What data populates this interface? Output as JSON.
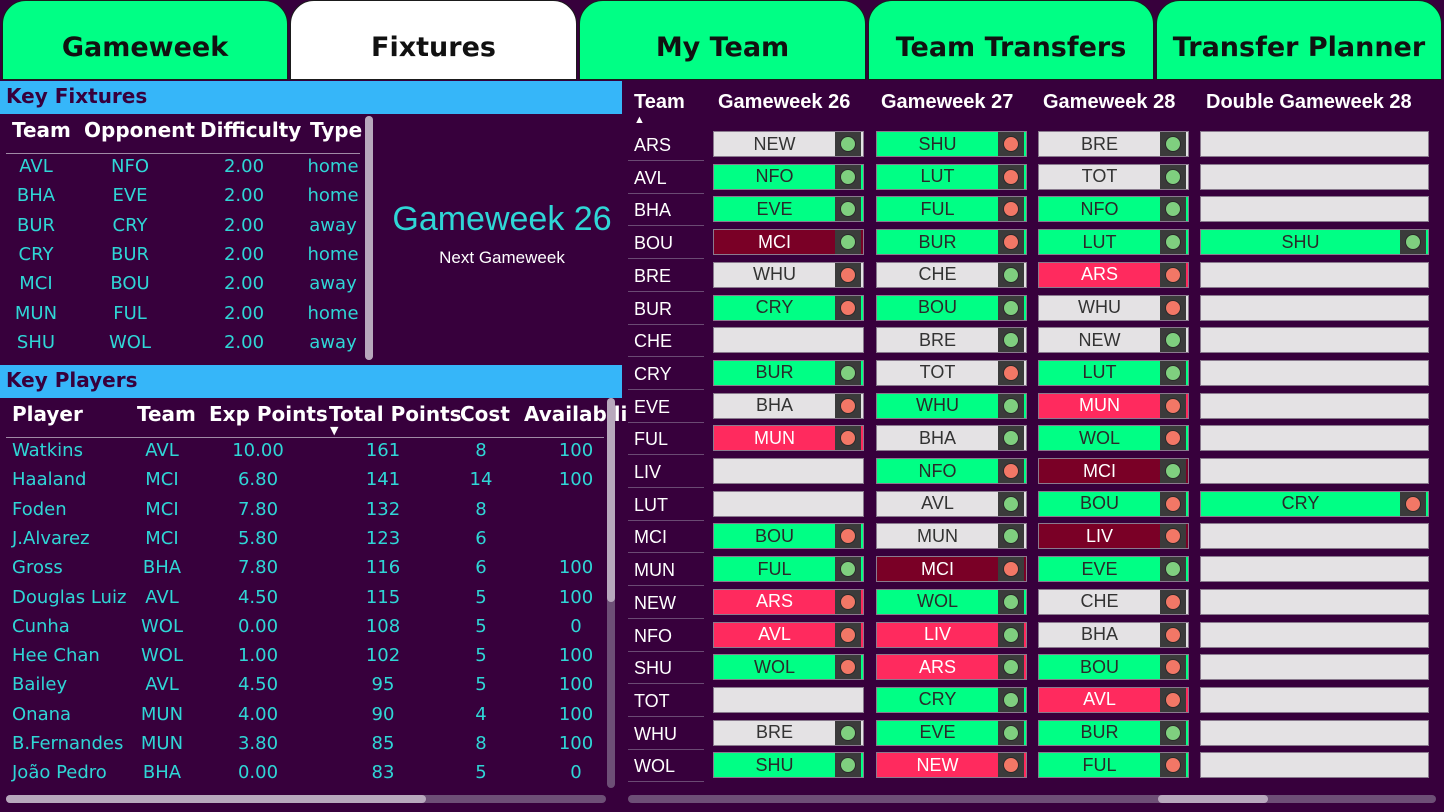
{
  "tabs": [
    {
      "label": "Gameweek",
      "active": false
    },
    {
      "label": "Fixtures",
      "active": true
    },
    {
      "label": "My Team",
      "active": false
    },
    {
      "label": "Team Transfers",
      "active": false
    },
    {
      "label": "Transfer Planner",
      "active": false
    }
  ],
  "key_fixtures": {
    "title": "Key Fixtures",
    "columns": [
      "Team",
      "Opponent",
      "Difficulty",
      "Type"
    ],
    "rows": [
      [
        "AVL",
        "NFO",
        "2.00",
        "home"
      ],
      [
        "BHA",
        "EVE",
        "2.00",
        "home"
      ],
      [
        "BUR",
        "CRY",
        "2.00",
        "away"
      ],
      [
        "CRY",
        "BUR",
        "2.00",
        "home"
      ],
      [
        "MCI",
        "BOU",
        "2.00",
        "away"
      ],
      [
        "MUN",
        "FUL",
        "2.00",
        "home"
      ],
      [
        "SHU",
        "WOL",
        "2.00",
        "away"
      ]
    ]
  },
  "gameweek_card": {
    "title": "Gameweek 26",
    "subtitle": "Next Gameweek"
  },
  "key_players": {
    "title": "Key Players",
    "columns": [
      "Player",
      "Team",
      "Exp Points",
      "Total Points",
      "Cost",
      "Availabili"
    ],
    "sort_column": "Total Points",
    "rows": [
      [
        "Watkins",
        "AVL",
        "10.00",
        "161",
        "8",
        "100"
      ],
      [
        "Haaland",
        "MCI",
        "6.80",
        "141",
        "14",
        "100"
      ],
      [
        "Foden",
        "MCI",
        "7.80",
        "132",
        "8",
        ""
      ],
      [
        "J.Alvarez",
        "MCI",
        "5.80",
        "123",
        "6",
        ""
      ],
      [
        "Gross",
        "BHA",
        "7.80",
        "116",
        "6",
        "100"
      ],
      [
        "Douglas Luiz",
        "AVL",
        "4.50",
        "115",
        "5",
        "100"
      ],
      [
        "Cunha",
        "WOL",
        "0.00",
        "108",
        "5",
        "0"
      ],
      [
        "Hee Chan",
        "WOL",
        "1.00",
        "102",
        "5",
        "100"
      ],
      [
        "Bailey",
        "AVL",
        "4.50",
        "95",
        "5",
        "100"
      ],
      [
        "Onana",
        "MUN",
        "4.00",
        "90",
        "4",
        "100"
      ],
      [
        "B.Fernandes",
        "MUN",
        "3.80",
        "85",
        "8",
        "100"
      ],
      [
        "João Pedro",
        "BHA",
        "0.00",
        "83",
        "5",
        "0"
      ]
    ]
  },
  "fixtures_grid": {
    "columns": [
      "Team",
      "Gameweek 26",
      "Gameweek 27",
      "Gameweek 28",
      "Double Gameweek 28"
    ],
    "sort_column": "Team",
    "colors": {
      "green": "#00ff85",
      "grey": "#e4e2e4",
      "pink": "#ff2a5e",
      "maroon": "#7a0026",
      "dot_green": "#7fcf7f",
      "dot_red": "#f27766"
    },
    "rows": [
      {
        "team": "ARS",
        "cells": [
          [
            "NEW",
            "grey",
            "green"
          ],
          [
            "SHU",
            "green",
            "red"
          ],
          [
            "BRE",
            "grey",
            "green"
          ],
          [
            "",
            "grey",
            ""
          ]
        ]
      },
      {
        "team": "AVL",
        "cells": [
          [
            "NFO",
            "green",
            "green"
          ],
          [
            "LUT",
            "green",
            "red"
          ],
          [
            "TOT",
            "grey",
            "green"
          ],
          [
            "",
            "grey",
            ""
          ]
        ]
      },
      {
        "team": "BHA",
        "cells": [
          [
            "EVE",
            "green",
            "green"
          ],
          [
            "FUL",
            "green",
            "red"
          ],
          [
            "NFO",
            "green",
            "green"
          ],
          [
            "",
            "grey",
            ""
          ]
        ]
      },
      {
        "team": "BOU",
        "cells": [
          [
            "MCI",
            "maroon",
            "green"
          ],
          [
            "BUR",
            "green",
            "red"
          ],
          [
            "LUT",
            "green",
            "green"
          ],
          [
            "SHU",
            "green",
            "green"
          ]
        ]
      },
      {
        "team": "BRE",
        "cells": [
          [
            "WHU",
            "grey",
            "red"
          ],
          [
            "CHE",
            "grey",
            "green"
          ],
          [
            "ARS",
            "pink",
            "red"
          ],
          [
            "",
            "grey",
            ""
          ]
        ]
      },
      {
        "team": "BUR",
        "cells": [
          [
            "CRY",
            "green",
            "red"
          ],
          [
            "BOU",
            "green",
            "green"
          ],
          [
            "WHU",
            "grey",
            "red"
          ],
          [
            "",
            "grey",
            ""
          ]
        ]
      },
      {
        "team": "CHE",
        "cells": [
          [
            "",
            "grey",
            ""
          ],
          [
            "BRE",
            "grey",
            "green"
          ],
          [
            "NEW",
            "grey",
            "green"
          ],
          [
            "",
            "grey",
            ""
          ]
        ]
      },
      {
        "team": "CRY",
        "cells": [
          [
            "BUR",
            "green",
            "green"
          ],
          [
            "TOT",
            "grey",
            "red"
          ],
          [
            "LUT",
            "green",
            "green"
          ],
          [
            "",
            "grey",
            ""
          ]
        ]
      },
      {
        "team": "EVE",
        "cells": [
          [
            "BHA",
            "grey",
            "red"
          ],
          [
            "WHU",
            "green",
            "green"
          ],
          [
            "MUN",
            "pink",
            "red"
          ],
          [
            "",
            "grey",
            ""
          ]
        ]
      },
      {
        "team": "FUL",
        "cells": [
          [
            "MUN",
            "pink",
            "red"
          ],
          [
            "BHA",
            "grey",
            "green"
          ],
          [
            "WOL",
            "green",
            "red"
          ],
          [
            "",
            "grey",
            ""
          ]
        ]
      },
      {
        "team": "LIV",
        "cells": [
          [
            "",
            "grey",
            ""
          ],
          [
            "NFO",
            "green",
            "red"
          ],
          [
            "MCI",
            "maroon",
            "green"
          ],
          [
            "",
            "grey",
            ""
          ]
        ]
      },
      {
        "team": "LUT",
        "cells": [
          [
            "",
            "grey",
            ""
          ],
          [
            "AVL",
            "grey",
            "green"
          ],
          [
            "BOU",
            "green",
            "red"
          ],
          [
            "CRY",
            "green",
            "red"
          ]
        ]
      },
      {
        "team": "MCI",
        "cells": [
          [
            "BOU",
            "green",
            "red"
          ],
          [
            "MUN",
            "grey",
            "green"
          ],
          [
            "LIV",
            "maroon",
            "red"
          ],
          [
            "",
            "grey",
            ""
          ]
        ]
      },
      {
        "team": "MUN",
        "cells": [
          [
            "FUL",
            "green",
            "green"
          ],
          [
            "MCI",
            "maroon",
            "red"
          ],
          [
            "EVE",
            "green",
            "green"
          ],
          [
            "",
            "grey",
            ""
          ]
        ]
      },
      {
        "team": "NEW",
        "cells": [
          [
            "ARS",
            "pink",
            "red"
          ],
          [
            "WOL",
            "green",
            "green"
          ],
          [
            "CHE",
            "grey",
            "red"
          ],
          [
            "",
            "grey",
            ""
          ]
        ]
      },
      {
        "team": "NFO",
        "cells": [
          [
            "AVL",
            "pink",
            "red"
          ],
          [
            "LIV",
            "pink",
            "green"
          ],
          [
            "BHA",
            "grey",
            "red"
          ],
          [
            "",
            "grey",
            ""
          ]
        ]
      },
      {
        "team": "SHU",
        "cells": [
          [
            "WOL",
            "green",
            "red"
          ],
          [
            "ARS",
            "pink",
            "green"
          ],
          [
            "BOU",
            "green",
            "red"
          ],
          [
            "",
            "grey",
            ""
          ]
        ]
      },
      {
        "team": "TOT",
        "cells": [
          [
            "",
            "grey",
            ""
          ],
          [
            "CRY",
            "green",
            "green"
          ],
          [
            "AVL",
            "pink",
            "red"
          ],
          [
            "",
            "grey",
            ""
          ]
        ]
      },
      {
        "team": "WHU",
        "cells": [
          [
            "BRE",
            "grey",
            "green"
          ],
          [
            "EVE",
            "green",
            "green"
          ],
          [
            "BUR",
            "green",
            "green"
          ],
          [
            "",
            "grey",
            ""
          ]
        ]
      },
      {
        "team": "WOL",
        "cells": [
          [
            "SHU",
            "green",
            "green"
          ],
          [
            "NEW",
            "pink",
            "red"
          ],
          [
            "FUL",
            "green",
            "red"
          ],
          [
            "",
            "grey",
            ""
          ]
        ]
      }
    ]
  }
}
